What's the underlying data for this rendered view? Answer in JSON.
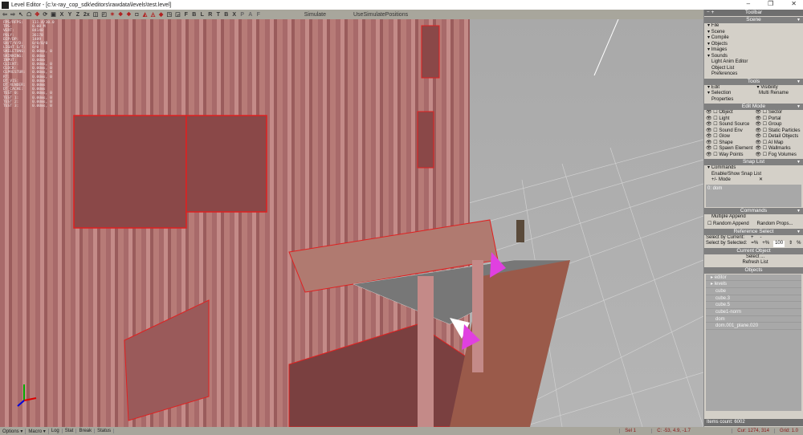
{
  "window": {
    "title": "Level Editor - [c:\\x-ray_cop_sdk\\editors\\rawdata\\levels\\test.level]",
    "minimize": "–",
    "maximize": "❐",
    "close": "✕"
  },
  "toolbar": {
    "axis_buttons": [
      "X",
      "Y",
      "Z",
      "2x"
    ],
    "view_buttons": [
      "F",
      "B",
      "L",
      "R",
      "T",
      "B",
      "X"
    ],
    "simulate": "Simulate",
    "use_simulate_positions": "UseSimulatePositions"
  },
  "stats": [
    "FPS/RFPS:    111.4/30.0",
    "TPS:         0.00 M",
    "VERT:        84140",
    "POLY:        36178",
    "DIP/DP:      1489",
    "SH/T/V/D:    0/0/0/0",
    "LIGHT S/T:   0/0",
    "SKELETONS:   0.00ms, 0",
    "SKINNING:    0.00ms",
    "",
    "INPUT:       0.00ms",
    "CLIENT:      0.00ms, 0",
    "CLOCK:       0.00ms, 0",
    "CLPRESTUR:   0.00ms, 0",
    "",
    "RT:          0.00ms, 0",
    "DT_VIS:      0.00ms",
    "DT_RENDER:   0.00ms",
    "DT_CACHE:    0.00ms",
    "",
    "TEST 0:      0.00ms, 0",
    "TEST 1:      0.00ms, 0",
    "TEST 2:      0.00ms, 0",
    "TEST 3:      0.00ms, 0"
  ],
  "panel": {
    "header": "Toolbar",
    "header_controls": "− +",
    "scene": {
      "title": "Scene",
      "items": [
        "File",
        "Scene",
        "Compile",
        "Objects",
        "Images",
        "Sounds"
      ],
      "links": [
        "Light Anim Editor",
        "Object List",
        "Preferences"
      ]
    },
    "tools": {
      "title": "Tools",
      "edit": "Edit",
      "visibility": "Visibility",
      "selection": "Selection",
      "multi_rename": "Multi Rename",
      "properties": "Properties"
    },
    "edit_mode": {
      "title": "Edit Mode",
      "left": [
        "Object",
        "Light",
        "Sound Source",
        "Sound Env",
        "Glow",
        "Shape",
        "Spawn Element",
        "Way Points"
      ],
      "right": [
        "Sector",
        "Portal",
        "Group",
        "Static Particles",
        "Detail Objects",
        "AI Map",
        "Wallmarks",
        "Fog Volumes"
      ]
    },
    "snap_list": {
      "title": "Snap List",
      "commands": "Commands",
      "enable_show": "Enable/Show Snap List",
      "mode": "+/- Mode",
      "x": "✕",
      "entries": [
        "0: dom"
      ]
    },
    "commands": {
      "title": "Commands",
      "multiple_append": "Multiple Append",
      "random_append": "Random Append",
      "random_props": "Random Props..."
    },
    "reference_select": {
      "title": "Reference Select",
      "by_current": "Select by Current:",
      "by_selected": "Select by Selected:",
      "plus": "+",
      "minus": "-",
      "plus_pct": "=%",
      "minus_pct": "+%",
      "value": "100",
      "pct": "%"
    },
    "current_object": {
      "title": "Current Object",
      "select": "Select ...",
      "refresh": "Refresh List"
    },
    "objects": {
      "title": "Objects",
      "items": [
        "editor",
        "levels",
        "cube",
        "cube.3",
        "cube.5",
        "cube1-norm",
        "dom",
        "dom.001_plane.020"
      ],
      "folders": [
        true,
        true,
        false,
        false,
        false,
        false,
        false,
        false
      ]
    },
    "item_count": "Items count: 6002"
  },
  "statusbar": {
    "options": "Options",
    "macro": "Macro",
    "log": "Log",
    "stat": "Stat",
    "break": "Break",
    "status": "Status",
    "sel": "Sel 1",
    "coords": "C: -53, 4.9, -1.7",
    "cursor": "Cur: 1274, 314",
    "grid": "Grid: 1.0"
  },
  "colors": {
    "wall": "#b07a77",
    "selection": "#e02020",
    "panel": "#d4d0c8",
    "panel_header": "#808080"
  }
}
